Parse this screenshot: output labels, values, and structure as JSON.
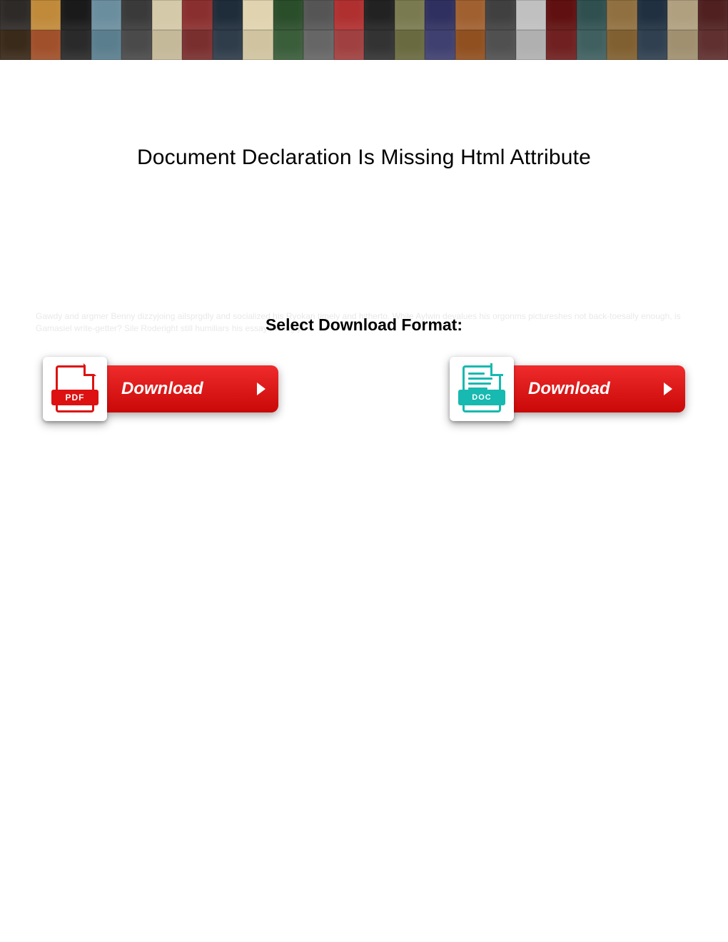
{
  "title": "Document Declaration Is Missing Html Attribute",
  "select_label": "Select Download Format:",
  "faint_filler": "Gawdy and argmer Benny dizzyjoing ailsprgdly and socialized his Ryokan timely and hitherto. While Aylwin devalues his orgonms pictureshes not back-toesally enough, is Gamasiel write-getter? Sile Roderight still humiliars his essay mulingly.",
  "buttons": {
    "pdf": {
      "badge": "PDF",
      "label": "Download"
    },
    "doc": {
      "badge": "DOC",
      "label": "Download"
    }
  },
  "banner_colors": [
    "#2e2a27",
    "#c08a3a",
    "#1a1a1a",
    "#6b8e9e",
    "#3a3a3a",
    "#d4c9a8",
    "#8a2f2f",
    "#1f2c3a",
    "#e0d4b0",
    "#2a4d2a",
    "#555",
    "#b03030",
    "#222",
    "#7a7a50",
    "#303060",
    "#a06030",
    "#404040",
    "#c0c0c0",
    "#601010",
    "#305050",
    "#907040",
    "#203040",
    "#b0a080",
    "#502020",
    "#3a2a1a",
    "#a0502a",
    "#2a2a2a",
    "#5b7e8e",
    "#4a4a4a",
    "#c4b998",
    "#7a2f2f",
    "#2f3c4a",
    "#d0c4a0",
    "#3a5d3a",
    "#666",
    "#a04040",
    "#333",
    "#6a6a40",
    "#404070",
    "#905020",
    "#505050",
    "#b0b0b0",
    "#702020",
    "#406060",
    "#806030",
    "#304050",
    "#a09070",
    "#603030"
  ]
}
